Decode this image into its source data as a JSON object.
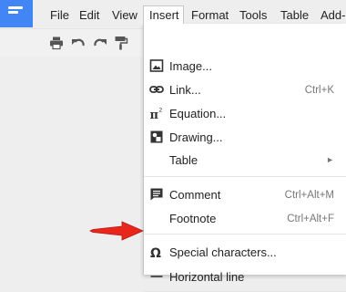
{
  "menubar": {
    "file": "File",
    "edit": "Edit",
    "view": "View",
    "insert": "Insert",
    "format": "Format",
    "tools": "Tools",
    "table": "Table",
    "addons": "Add-o"
  },
  "toolbar": {
    "icons": [
      "printer-icon",
      "undo-icon",
      "redo-icon",
      "paint-format-icon"
    ]
  },
  "insert_menu": {
    "image": {
      "label": "Image...",
      "icon": "image-icon"
    },
    "link": {
      "label": "Link...",
      "shortcut": "Ctrl+K",
      "icon": "link-icon"
    },
    "equation": {
      "label": "Equation...",
      "icon": "equation-icon"
    },
    "drawing": {
      "label": "Drawing...",
      "icon": "drawing-icon"
    },
    "table": {
      "label": "Table",
      "submenu_arrow": "►"
    },
    "comment": {
      "label": "Comment",
      "shortcut": "Ctrl+Alt+M",
      "icon": "comment-icon"
    },
    "footnote": {
      "label": "Footnote",
      "shortcut": "Ctrl+Alt+F"
    },
    "special_characters": {
      "label": "Special characters...",
      "icon_glyph": "Ω"
    },
    "horizontal_line": {
      "label": "Horizontal line",
      "icon": "horizontal-line-icon"
    }
  },
  "colors": {
    "menu_bg": "#ffffff",
    "page_bg": "#eeeeee",
    "docs_blue": "#4285f4",
    "annotation_red": "#e8261c",
    "shortcut_gray": "#777777"
  }
}
